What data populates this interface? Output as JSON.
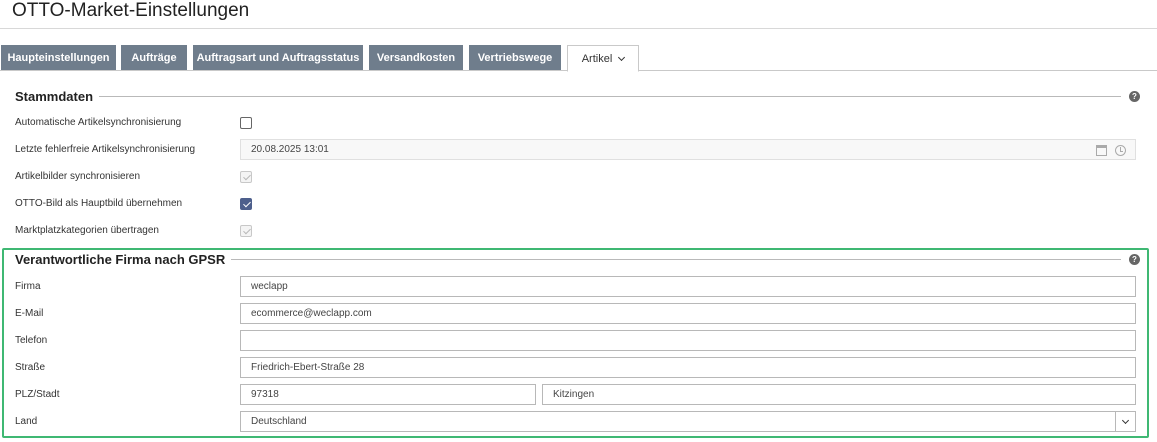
{
  "page": {
    "title": "OTTO-Market-Einstellungen"
  },
  "tabs": [
    {
      "label": "Haupteinstellungen"
    },
    {
      "label": "Aufträge"
    },
    {
      "label": "Auftragsart und Auftragsstatus"
    },
    {
      "label": "Versandkosten"
    },
    {
      "label": "Vertriebswege"
    },
    {
      "label": "Artikel",
      "active": true
    }
  ],
  "stammdaten": {
    "title": "Stammdaten",
    "help_icon": "question-mark",
    "rows": [
      {
        "label": "Automatische Artikelsynchronisierung",
        "type": "checkbox",
        "checked": false,
        "disabled": false
      },
      {
        "label": "Letzte fehlerfreie Artikelsynchronisierung",
        "type": "datetime",
        "value": "20.08.2025 13:01"
      },
      {
        "label": "Artikelbilder synchronisieren",
        "type": "checkbox",
        "checked": true,
        "disabled": true
      },
      {
        "label": "OTTO-Bild als Hauptbild übernehmen",
        "type": "checkbox",
        "checked": true,
        "disabled": false
      },
      {
        "label": "Marktplatzkategorien übertragen",
        "type": "checkbox",
        "checked": true,
        "disabled": true
      }
    ]
  },
  "gpsr": {
    "title": "Verantwortliche Firma nach GPSR",
    "help_icon": "question-mark",
    "firma": {
      "label": "Firma",
      "value": "weclapp"
    },
    "email": {
      "label": "E-Mail",
      "value": "ecommerce@weclapp.com"
    },
    "telefon": {
      "label": "Telefon",
      "value": ""
    },
    "strasse": {
      "label": "Straße",
      "value": "Friedrich-Ebert-Straße 28"
    },
    "plz_stadt": {
      "label": "PLZ/Stadt",
      "plz": "97318",
      "stadt": "Kitzingen"
    },
    "land": {
      "label": "Land",
      "value": "Deutschland"
    }
  },
  "colors": {
    "tab_inactive": "#6f7d8c",
    "checkbox_checked": "#4d5f8c",
    "highlight": "#3fb873"
  }
}
